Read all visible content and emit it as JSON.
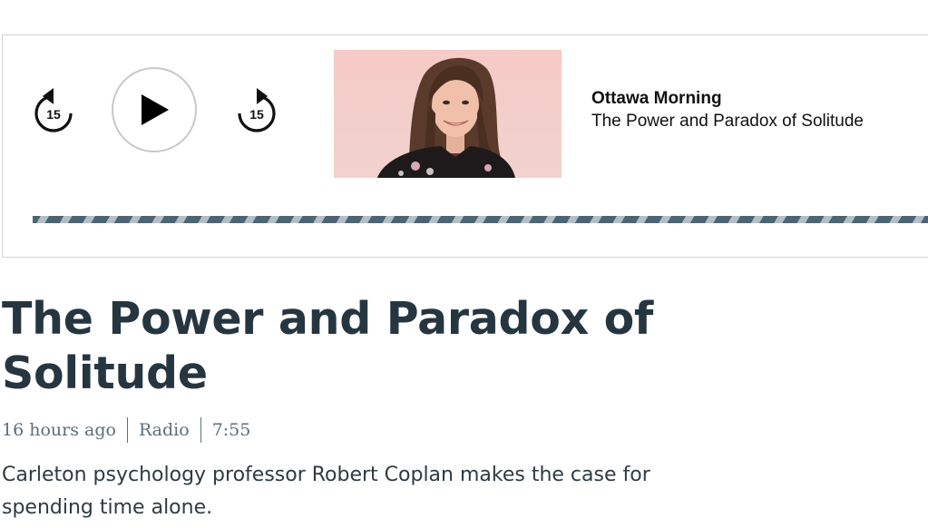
{
  "player": {
    "skip_back_seconds": "15",
    "skip_forward_seconds": "15",
    "show_name": "Ottawa Morning",
    "episode_title": "The Power and Paradox of Solitude",
    "progress_fraction": 0.0,
    "accent_color": "#4d6472"
  },
  "article": {
    "headline": "The Power and Paradox of Solitude",
    "time_ago": "16 hours ago",
    "category": "Radio",
    "duration": "7:55",
    "summary": "Carleton psychology professor Robert Coplan makes the case for spending time alone."
  },
  "icons": {
    "skip_back": "rewind-15-icon",
    "play": "play-icon",
    "skip_forward": "forward-15-icon"
  }
}
